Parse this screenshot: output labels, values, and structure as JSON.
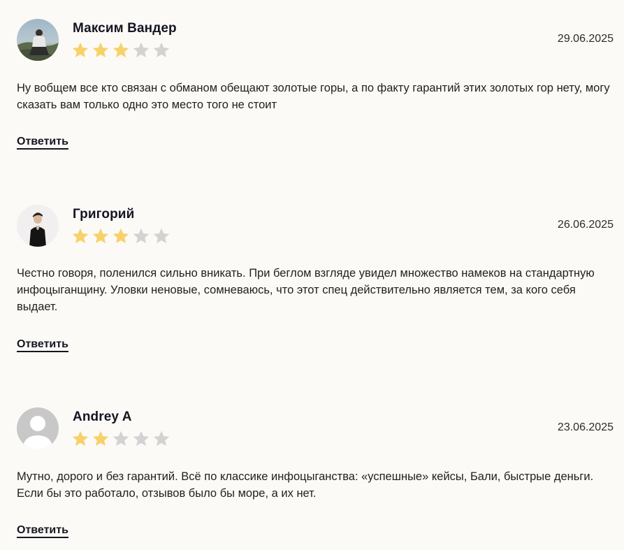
{
  "reviews": [
    {
      "author": "Максим Вандер",
      "date": "29.06.2025",
      "rating": 3,
      "max_rating": 5,
      "avatar": "user-photo-outdoor",
      "text": "Ну вобщем все кто связан с обманом обещают золотые горы, а по факту гарантий этих золотых гор нету, могу сказать вам только одно это место того не стоит",
      "reply_label": "Ответить"
    },
    {
      "author": "Григорий",
      "date": "26.06.2025",
      "rating": 3,
      "max_rating": 5,
      "avatar": "user-photo-portrait",
      "text": "Честно говоря, поленился сильно вникать. При беглом взгляде увидел множество намеков на стандартную инфоцыганщину. Уловки неновые, сомневаюсь, что этот спец действительно является тем, за кого себя выдает.",
      "reply_label": "Ответить"
    },
    {
      "author": "Andrey A",
      "date": "23.06.2025",
      "rating": 2,
      "max_rating": 5,
      "avatar": "default-user-icon",
      "text": "Мутно, дорого и без гарантий. Всё по классике инфоцыганства: «успешные» кейсы, Бали, быстрые деньги. Если бы это работало, отзывов было бы море, а их нет.",
      "reply_label": "Ответить"
    }
  ],
  "colors": {
    "background": "#fcfaf6",
    "star_filled": "#f7d26a",
    "star_empty": "#d3d3d3",
    "text": "#1f1f1f",
    "name": "#151522"
  },
  "icons": {
    "star": "star-icon",
    "default_avatar": "default-user-icon"
  }
}
